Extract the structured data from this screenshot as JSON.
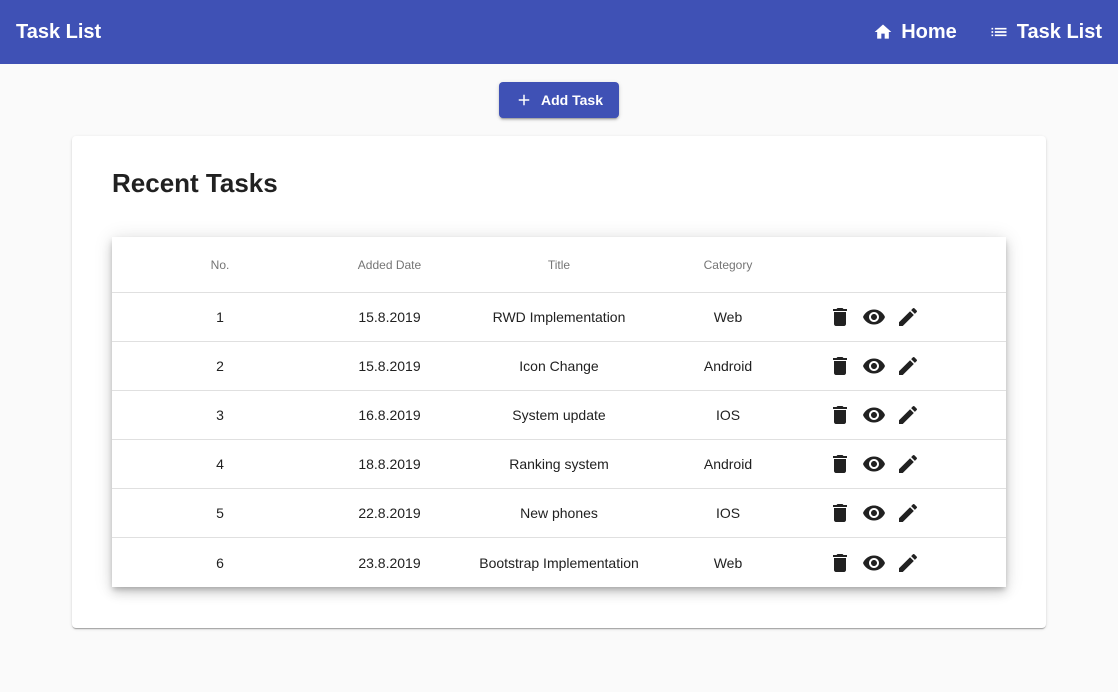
{
  "app": {
    "title": "Task List"
  },
  "nav": [
    {
      "label": "Home",
      "icon": "home-icon"
    },
    {
      "label": "Task List",
      "icon": "list-icon"
    }
  ],
  "add_button": {
    "label": "Add Task",
    "icon": "plus-icon"
  },
  "card": {
    "title": "Recent Tasks"
  },
  "table": {
    "columns": [
      "No.",
      "Added Date",
      "Title",
      "Category",
      ""
    ],
    "rows": [
      {
        "no": "1",
        "date": "15.8.2019",
        "title": "RWD Implementation",
        "category": "Web"
      },
      {
        "no": "2",
        "date": "15.8.2019",
        "title": "Icon Change",
        "category": "Android"
      },
      {
        "no": "3",
        "date": "16.8.2019",
        "title": "System update",
        "category": "IOS"
      },
      {
        "no": "4",
        "date": "18.8.2019",
        "title": "Ranking system",
        "category": "Android"
      },
      {
        "no": "5",
        "date": "22.8.2019",
        "title": "New phones",
        "category": "IOS"
      },
      {
        "no": "6",
        "date": "23.8.2019",
        "title": "Bootstrap Implementation",
        "category": "Web"
      }
    ],
    "row_actions": [
      "delete-icon",
      "view-icon",
      "edit-icon"
    ]
  },
  "colors": {
    "primary": "#3f51b5",
    "background": "#fafafa"
  }
}
